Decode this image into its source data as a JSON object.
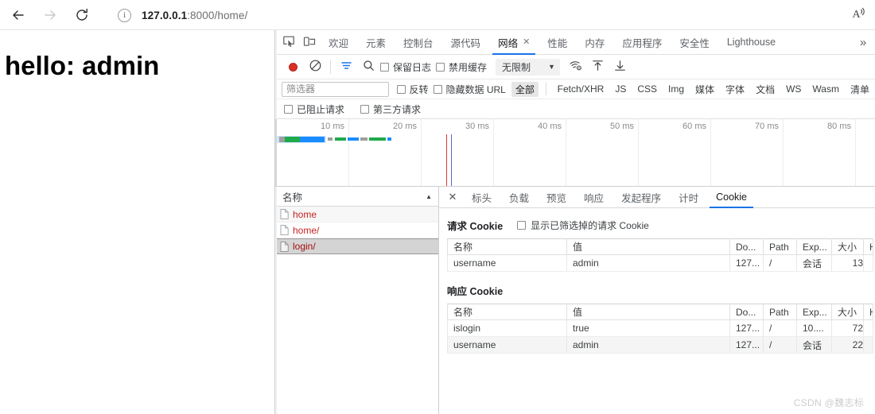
{
  "browser": {
    "back_label": "back-arrow",
    "forward_label": "forward-arrow",
    "reload_label": "reload",
    "url_host": "127.0.0.1",
    "url_rest": ":8000/home/",
    "read_aloud_label": "A"
  },
  "page": {
    "heading": "hello: admin"
  },
  "devtools": {
    "tabs": [
      {
        "label": "欢迎",
        "active": false,
        "closable": false
      },
      {
        "label": "元素",
        "active": false,
        "closable": false
      },
      {
        "label": "控制台",
        "active": false,
        "closable": false
      },
      {
        "label": "源代码",
        "active": false,
        "closable": false
      },
      {
        "label": "网络",
        "active": true,
        "closable": true,
        "close": "✕"
      },
      {
        "label": "性能",
        "active": false,
        "closable": false
      },
      {
        "label": "内存",
        "active": false,
        "closable": false
      },
      {
        "label": "应用程序",
        "active": false,
        "closable": false
      },
      {
        "label": "安全性",
        "active": false,
        "closable": false
      },
      {
        "label": "Lighthouse",
        "active": false,
        "closable": false
      }
    ],
    "more_label": "»",
    "toolbar": {
      "record_label": "record",
      "clear_label": "clear",
      "filter_label": "filter",
      "search_label": "search",
      "preserve_log": "保留日志",
      "disable_cache": "禁用缓存",
      "throttle_value": "无限制",
      "throttle_caret": "▼",
      "network_conditions_label": "network-conditions",
      "import_har_label": "import-har",
      "export_har_label": "export-har"
    },
    "filterbar": {
      "filter_placeholder": "筛选器",
      "invert": "反转",
      "hide_data_urls": "隐藏数据 URL",
      "chips": [
        {
          "label": "全部",
          "active": true
        },
        {
          "label": "Fetch/XHR",
          "active": false
        },
        {
          "label": "JS",
          "active": false
        },
        {
          "label": "CSS",
          "active": false
        },
        {
          "label": "Img",
          "active": false
        },
        {
          "label": "媒体",
          "active": false
        },
        {
          "label": "字体",
          "active": false
        },
        {
          "label": "文档",
          "active": false
        },
        {
          "label": "WS",
          "active": false
        },
        {
          "label": "Wasm",
          "active": false
        },
        {
          "label": "清单",
          "active": false
        }
      ]
    },
    "blockedbar": {
      "blocked_requests": "已阻止请求",
      "third_party_requests": "第三方请求"
    },
    "overview": {
      "ticks": [
        "10 ms",
        "20 ms",
        "30 ms",
        "40 ms",
        "50 ms",
        "60 ms",
        "70 ms",
        "80 ms"
      ],
      "marker_red_color": "#e53935",
      "marker_blue_color": "#5c6bc0",
      "bar_blue": "#1a8cff",
      "bar_green": "#1faa4b",
      "bar_grey": "#9e9e9e"
    },
    "request_list": {
      "column_header": "名称",
      "sort_indicator": "▲",
      "rows": [
        {
          "name": "home",
          "selected": false
        },
        {
          "name": "home/",
          "selected": false
        },
        {
          "name": "login/",
          "selected": true
        }
      ]
    },
    "detail": {
      "close_label": "✕",
      "tabs": [
        {
          "label": "标头",
          "active": false
        },
        {
          "label": "负载",
          "active": false
        },
        {
          "label": "预览",
          "active": false
        },
        {
          "label": "响应",
          "active": false
        },
        {
          "label": "发起程序",
          "active": false
        },
        {
          "label": "计时",
          "active": false
        },
        {
          "label": "Cookie",
          "active": true
        }
      ],
      "request_cookies_title": "请求 Cookie",
      "show_filtered_label": "显示已筛选掉的请求 Cookie",
      "response_cookies_title": "响应 Cookie",
      "columns": [
        "名称",
        "值",
        "Do...",
        "Path",
        "Exp...",
        "大小",
        "Htt."
      ],
      "request_cookies": [
        {
          "name": "username",
          "value": "admin",
          "domain": "127...",
          "path": "/",
          "expires": "会话",
          "size": "13",
          "http": ""
        }
      ],
      "response_cookies": [
        {
          "name": "islogin",
          "value": "true",
          "domain": "127...",
          "path": "/",
          "expires": "10....",
          "size": "72",
          "http": ""
        },
        {
          "name": "username",
          "value": "admin",
          "domain": "127...",
          "path": "/",
          "expires": "会话",
          "size": "22",
          "http": ""
        }
      ]
    }
  },
  "watermark": "CSDN @魏志标"
}
